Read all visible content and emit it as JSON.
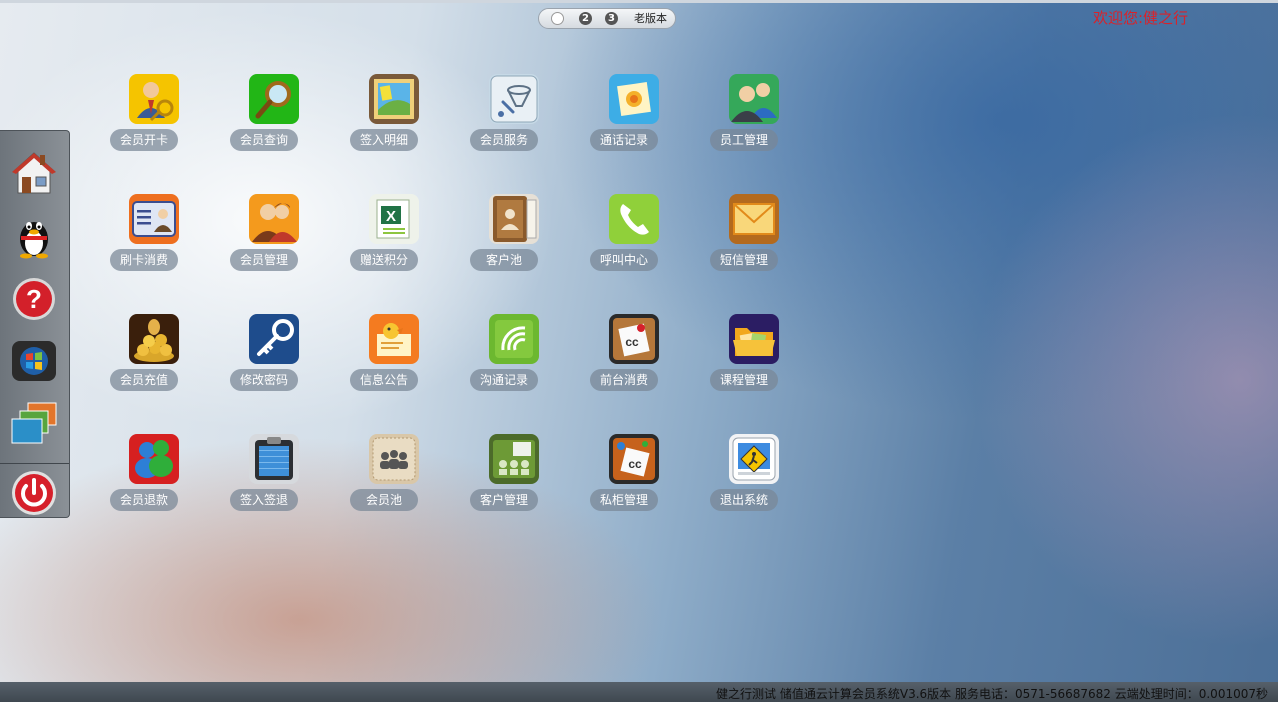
{
  "pager": {
    "page2": "2",
    "page3": "3",
    "old_version": "老版本"
  },
  "welcome": "欢迎您:健之行",
  "dock": [
    {
      "name": "home-icon"
    },
    {
      "name": "qq-icon"
    },
    {
      "name": "help-icon"
    },
    {
      "name": "windows-icon"
    },
    {
      "name": "windows-stack-icon"
    },
    {
      "name": "power-icon"
    }
  ],
  "apps": [
    {
      "label": "会员开卡",
      "icon": "member-card-icon"
    },
    {
      "label": "会员查询",
      "icon": "magnifier-icon"
    },
    {
      "label": "签入明细",
      "icon": "photo-frame-icon"
    },
    {
      "label": "会员服务",
      "icon": "funnel-icon"
    },
    {
      "label": "通话记录",
      "icon": "flower-photo-icon"
    },
    {
      "label": "员工管理",
      "icon": "users-icon"
    },
    {
      "label": "刷卡消费",
      "icon": "id-card-icon"
    },
    {
      "label": "会员管理",
      "icon": "couple-icon"
    },
    {
      "label": "赠送积分",
      "icon": "excel-icon"
    },
    {
      "label": "客户池",
      "icon": "address-book-icon"
    },
    {
      "label": "呼叫中心",
      "icon": "phone-icon"
    },
    {
      "label": "短信管理",
      "icon": "envelope-icon"
    },
    {
      "label": "会员充值",
      "icon": "coins-icon"
    },
    {
      "label": "修改密码",
      "icon": "key-icon"
    },
    {
      "label": "信息公告",
      "icon": "bulletin-icon"
    },
    {
      "label": "沟通记录",
      "icon": "signal-icon"
    },
    {
      "label": "前台消费",
      "icon": "sticky-note-icon"
    },
    {
      "label": "课程管理",
      "icon": "folder-icon"
    },
    {
      "label": "会员退款",
      "icon": "msn-users-icon"
    },
    {
      "label": "签入签退",
      "icon": "clipboard-icon"
    },
    {
      "label": "会员池",
      "icon": "group-icon"
    },
    {
      "label": "客户管理",
      "icon": "customer-board-icon"
    },
    {
      "label": "私柜管理",
      "icon": "note-board-icon"
    },
    {
      "label": "退出系统",
      "icon": "exit-icon"
    }
  ],
  "status": "健之行测试 储值通云计算会员系统V3.6版本 服务电话：0571-56687682 云端处理时间：0.001007秒"
}
